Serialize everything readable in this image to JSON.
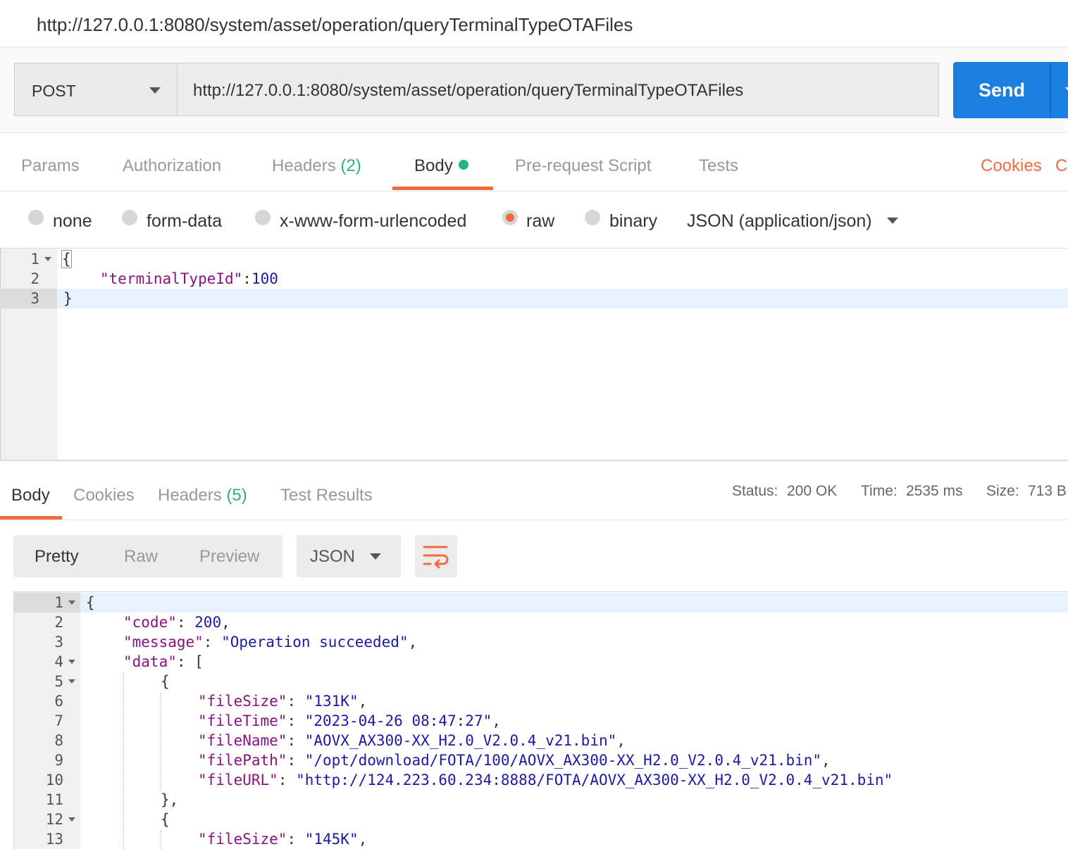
{
  "title": "http://127.0.0.1:8080/system/asset/operation/queryTerminalTypeOTAFiles",
  "request": {
    "method": "POST",
    "url": "http://127.0.0.1:8080/system/asset/operation/queryTerminalTypeOTAFiles",
    "send_label": "Send"
  },
  "request_tabs": {
    "params": "Params",
    "authorization": "Authorization",
    "headers": "Headers",
    "headers_count": "(2)",
    "body": "Body",
    "prerequest": "Pre-request Script",
    "tests": "Tests",
    "cookies": "Cookies",
    "code_partial": "C"
  },
  "body_modes": {
    "none": "none",
    "form_data": "form-data",
    "urlencoded": "x-www-form-urlencoded",
    "raw": "raw",
    "binary": "binary",
    "content_type": "JSON (application/json)"
  },
  "request_body": {
    "line_numbers": [
      "1",
      "2",
      "3"
    ],
    "open": "{",
    "key": "\"terminalTypeId\"",
    "sep": ":",
    "value": "100",
    "close": "}"
  },
  "response_tabs": {
    "body": "Body",
    "cookies": "Cookies",
    "headers": "Headers",
    "headers_count": "(5)",
    "test_results": "Test Results"
  },
  "status": {
    "status_label": "Status:",
    "status_value": "200 OK",
    "time_label": "Time:",
    "time_value": "2535 ms",
    "size_label": "Size:",
    "size_value": "713 B"
  },
  "view_modes": {
    "pretty": "Pretty",
    "raw": "Raw",
    "preview": "Preview",
    "format": "JSON"
  },
  "response_body": {
    "line_numbers": [
      "1",
      "2",
      "3",
      "4",
      "5",
      "6",
      "7",
      "8",
      "9",
      "10",
      "11",
      "12",
      "13"
    ],
    "l1": "{",
    "code_key": "\"code\"",
    "code_val": "200",
    "message_key": "\"message\"",
    "message_val": "\"Operation succeeded\"",
    "data_key": "\"data\"",
    "data_open": "[",
    "obj_open": "{",
    "fileSize_key": "\"fileSize\"",
    "fileSize_val": "\"131K\"",
    "fileTime_key": "\"fileTime\"",
    "fileTime_val": "\"2023-04-26 08:47:27\"",
    "fileName_key": "\"fileName\"",
    "fileName_val": "\"AOVX_AX300-XX_H2.0_V2.0.4_v21.bin\"",
    "filePath_key": "\"filePath\"",
    "filePath_val": "\"/opt/download/FOTA/100/AOVX_AX300-XX_H2.0_V2.0.4_v21.bin\"",
    "fileURL_key": "\"fileURL\"",
    "fileURL_val": "\"http://124.223.60.234:8888/FOTA/AOVX_AX300-XX_H2.0_V2.0.4_v21.bin\"",
    "obj_close": "},",
    "obj2_open": "{",
    "fileSize2_key": "\"fileSize\"",
    "fileSize2_val": "\"145K\""
  },
  "colors": {
    "accent": "#f26b3a",
    "send": "#1a80e0",
    "success": "#26b47f"
  }
}
